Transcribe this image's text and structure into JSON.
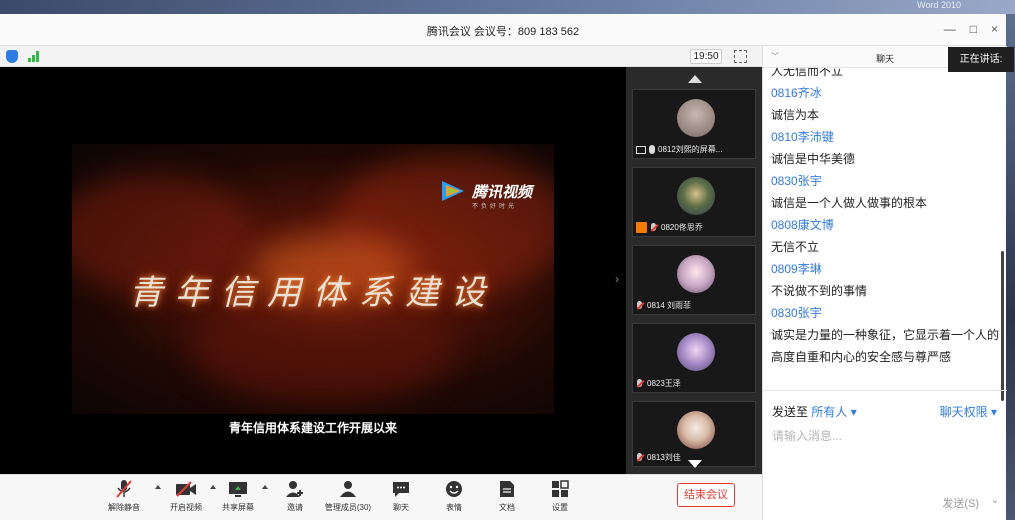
{
  "desktop": {
    "word_label": "Word 2010"
  },
  "window": {
    "title": "腾讯会议 会议号：809 183 562",
    "controls": [
      "—",
      "□",
      "×"
    ],
    "speaking_tip": "正在讲话:"
  },
  "video_bar": {
    "time": "19:50"
  },
  "main_video": {
    "logo_text": "腾讯视频",
    "logo_sub": "不负好时光",
    "headline": "青年信用体系建设",
    "subtitle": "青年信用体系建设工作开展以来"
  },
  "participants": [
    {
      "name": "0812刘熙的屏幕...",
      "status": "screen",
      "avatar_color": "#8b7d78"
    },
    {
      "name": "0820佟思乔",
      "status": "host-muted",
      "avatar_color": "#4a5b3a"
    },
    {
      "name": "0814 刘雨菲",
      "status": "muted",
      "avatar_color": "#c9b7c9"
    },
    {
      "name": "0823王泽",
      "status": "muted",
      "avatar_color": "#9c7fb0"
    },
    {
      "name": "0813刘佳",
      "status": "muted",
      "avatar_color": "#6b4a3a"
    }
  ],
  "toolbar": {
    "mute_label": "解除静音",
    "video_label": "开启视频",
    "share_label": "共享屏幕",
    "invite_label": "邀请",
    "manage_label": "管理成员(30)",
    "chat_label": "聊天",
    "emoji_label": "表情",
    "docs_label": "文档",
    "settings_label": "设置",
    "end_label": "结束会议"
  },
  "chat": {
    "title": "聊天",
    "messages": [
      {
        "sender": "",
        "text": "人无信而不立"
      },
      {
        "sender": "0816齐冰",
        "text": "诚信为本"
      },
      {
        "sender": "0810李沛键",
        "text": "诚信是中华美德"
      },
      {
        "sender": "0830张宇",
        "text": "诚信是一个人做人做事的根本"
      },
      {
        "sender": "0808康文博",
        "text": "无信不立"
      },
      {
        "sender": "0809李琳",
        "text": "不说做不到的事情"
      },
      {
        "sender": "0830张宇",
        "text": "诚实是力量的一种象征，它显示着一个人的高度自重和内心的安全感与尊严感"
      }
    ],
    "send_to_label": "发送至",
    "send_to_target": "所有人",
    "permission_label": "聊天权限",
    "input_placeholder": "请输入消息...",
    "send_label": "发送(S)",
    "accent": "#2f7be5"
  }
}
